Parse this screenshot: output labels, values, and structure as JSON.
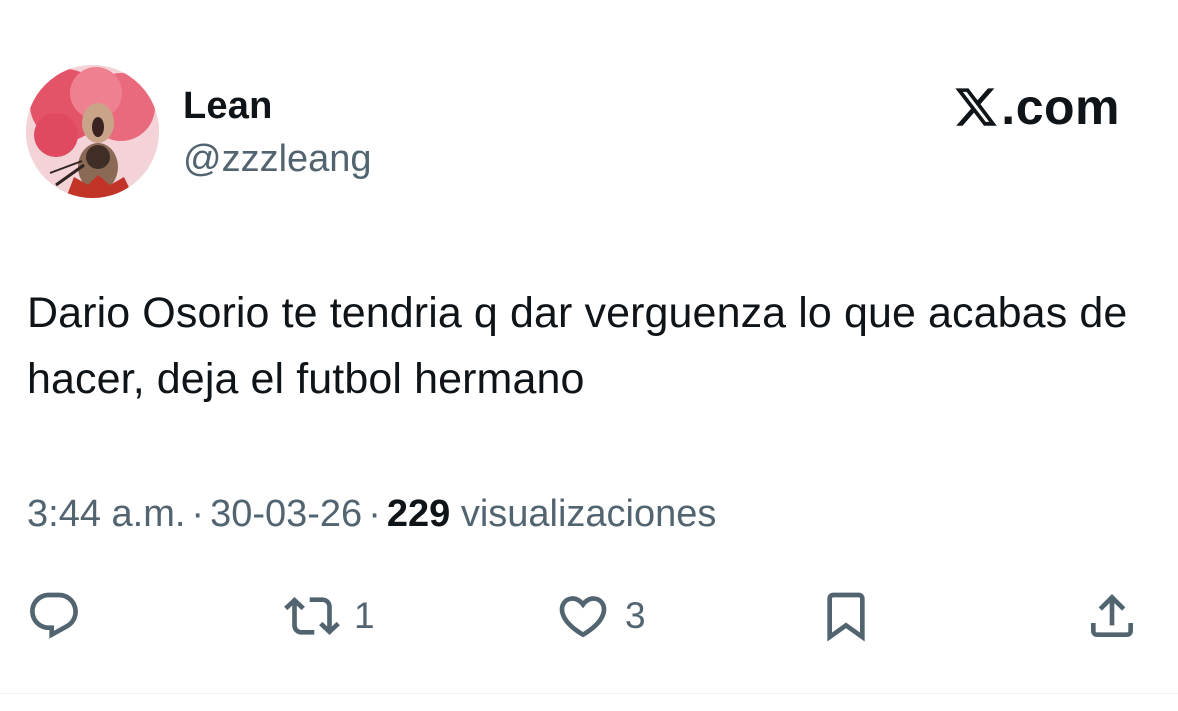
{
  "app": {
    "brand_text": ".com",
    "brand_icon": "x-logo-icon"
  },
  "author": {
    "name": "Lean",
    "handle": "@zzzleang",
    "avatar": "avatar-image"
  },
  "tweet": {
    "text": "Dario Osorio te tendria q dar verguenza lo que acabas de hacer, deja el futbol hermano",
    "time": "3:44 a.m.",
    "date": "30-03-26",
    "separator": "·",
    "views_count": "229",
    "views_label": "visualizaciones"
  },
  "actions": {
    "reply": {
      "icon": "reply-icon"
    },
    "retweet": {
      "icon": "retweet-icon",
      "count": "1"
    },
    "like": {
      "icon": "heart-icon",
      "count": "3"
    },
    "bookmark": {
      "icon": "bookmark-icon"
    },
    "share": {
      "icon": "share-icon"
    }
  },
  "colors": {
    "primary_text": "#0f1419",
    "secondary_text": "#536471",
    "avatar_accent": "#e84a63",
    "background": "#ffffff"
  }
}
